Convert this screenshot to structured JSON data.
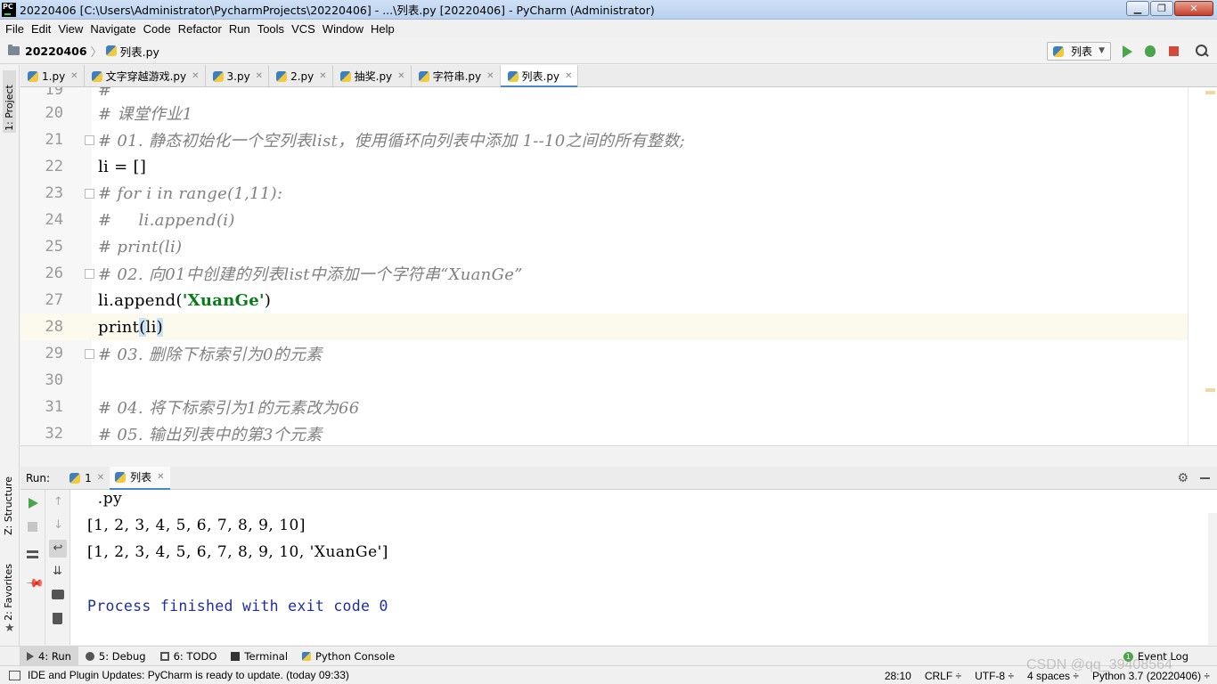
{
  "window": {
    "title": "20220406 [C:\\Users\\Administrator\\PycharmProjects\\20220406] - ...\\列表.py [20220406] - PyCharm (Administrator)",
    "logo_text": "PC",
    "minimize": "▁",
    "restore": "❐",
    "close": "✕"
  },
  "menu": [
    "File",
    "Edit",
    "View",
    "Navigate",
    "Code",
    "Refactor",
    "Run",
    "Tools",
    "VCS",
    "Window",
    "Help"
  ],
  "navbar": {
    "project": "20220406",
    "separator": "〉",
    "file": "列表.py",
    "run_config": "列表"
  },
  "left_stripe": {
    "project": "1: Project",
    "structure": "Z: Structure",
    "favorites": "2: Favorites"
  },
  "editor_tabs": [
    {
      "label": "1.py",
      "active": false
    },
    {
      "label": "文字穿越游戏.py",
      "active": false
    },
    {
      "label": "3.py",
      "active": false
    },
    {
      "label": "2.py",
      "active": false
    },
    {
      "label": "抽奖.py",
      "active": false
    },
    {
      "label": "字符串.py",
      "active": false
    },
    {
      "label": "列表.py",
      "active": true
    }
  ],
  "code": {
    "partial_top": {
      "num": "19",
      "text": "#"
    },
    "lines": [
      {
        "num": "20",
        "text": "# 课堂作业1",
        "type": "comment"
      },
      {
        "num": "21",
        "text": "# 01. 静态初始化一个空列表list，使用循环向列表中添加 1--10之间的所有整数;",
        "type": "comment"
      },
      {
        "num": "22",
        "text": "li = []",
        "type": "code"
      },
      {
        "num": "23",
        "text": "# for i in range(1,11):",
        "type": "comment"
      },
      {
        "num": "24",
        "text": "#     li.append(i)",
        "type": "comment"
      },
      {
        "num": "25",
        "text": "# print(li)",
        "type": "comment"
      },
      {
        "num": "26",
        "text": "# 02. 向01中创建的列表list中添加一个字符串“XuanGe”",
        "type": "comment"
      },
      {
        "num": "27",
        "pre": "li.append(",
        "str": "'XuanGe'",
        "post": ")",
        "type": "code"
      },
      {
        "num": "28",
        "pre": "print",
        "b1": "(",
        "mid": "li",
        "b2": ")",
        "type": "code"
      },
      {
        "num": "29",
        "text": "# 03. 删除下标索引为0的元素",
        "type": "comment"
      },
      {
        "num": "30",
        "text": "",
        "type": "code"
      },
      {
        "num": "31",
        "text": "# 04. 将下标索引为1的元素改为66",
        "type": "comment"
      },
      {
        "num": "32",
        "text": "# 05. 输出列表中的第3个元素",
        "type": "comment"
      }
    ]
  },
  "run_panel": {
    "label": "Run:",
    "tabs": [
      "1",
      "列表"
    ],
    "output": [
      "  .py",
      "[1, 2, 3, 4, 5, 6, 7, 8, 9, 10]",
      "[1, 2, 3, 4, 5, 6, 7, 8, 9, 10, 'XuanGe']",
      "",
      "Process finished with exit code 0"
    ]
  },
  "tool_windows": {
    "run": "4: Run",
    "debug": "5: Debug",
    "todo": "6: TODO",
    "terminal": "Terminal",
    "python_console": "Python Console",
    "event_log": "Event Log",
    "event_count": "1"
  },
  "status": {
    "message": "IDE and Plugin Updates: PyCharm is ready to update. (today 09:33)",
    "position": "28:10",
    "line_sep": "CRLF ÷",
    "encoding": "UTF-8 ÷",
    "indent": "4 spaces ÷",
    "interpreter": "Python 3.7 (20220406) ÷"
  },
  "watermark": "CSDN @qq_39408564",
  "colors": {
    "accent": "#4a88c7",
    "string": "#067d17",
    "comment": "#808080",
    "console_process": "#1f2fa0",
    "run_green": "#4ba64b",
    "stop_red": "#d14a3a"
  }
}
